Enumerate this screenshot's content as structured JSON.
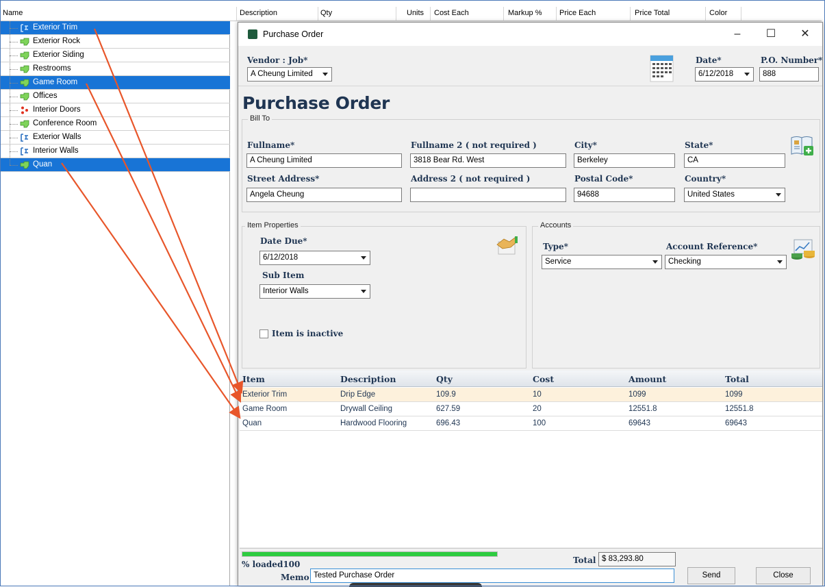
{
  "grid": {
    "columns": [
      "Name",
      "Description",
      "Qty",
      "Units",
      "Cost Each",
      "Markup %",
      "Price Each",
      "Price Total",
      "Color"
    ],
    "tree_items": [
      {
        "label": "Exterior Trim",
        "icon": "tree-node-icon",
        "selected": true
      },
      {
        "label": "Exterior Rock",
        "icon": "green-item-icon",
        "selected": false
      },
      {
        "label": "Exterior Siding",
        "icon": "green-item-icon",
        "selected": false
      },
      {
        "label": "Restrooms",
        "icon": "green-item-icon",
        "selected": false
      },
      {
        "label": "Game Room",
        "icon": "green-item-icon",
        "selected": true
      },
      {
        "label": "Offices",
        "icon": "green-item-icon",
        "selected": false
      },
      {
        "label": "Interior Doors",
        "icon": "red-dots-icon",
        "selected": false
      },
      {
        "label": "Conference Room",
        "icon": "green-item-icon",
        "selected": false
      },
      {
        "label": "Exterior Walls",
        "icon": "tree-node-icon",
        "selected": false
      },
      {
        "label": "Interior Walls",
        "icon": "tree-node-icon",
        "selected": false
      },
      {
        "label": "Quan",
        "icon": "green-item-icon",
        "selected": true
      }
    ]
  },
  "dialog": {
    "title": "Purchase Order",
    "heading": "Purchase Order",
    "vendor_job_label": "Vendor : Job*",
    "vendor_job_value": "A Cheung Limited",
    "date_label": "Date*",
    "date_value": "6/12/2018",
    "po_label": "P.O. Number*",
    "po_value": "888",
    "bill_to": {
      "title": "Bill To",
      "fullname_label": "Fullname*",
      "fullname_value": "A Cheung Limited",
      "fullname2_label": "Fullname 2 ( not required )",
      "fullname2_value": "3818 Bear Rd. West",
      "city_label": "City*",
      "city_value": "Berkeley",
      "state_label": "State*",
      "state_value": "CA",
      "street_label": "Street Address*",
      "street_value": "Angela Cheung",
      "address2_label": "Address 2 ( not required )",
      "address2_value": "",
      "postal_label": "Postal Code*",
      "postal_value": "94688",
      "country_label": "Country*",
      "country_value": "United States"
    },
    "item_properties": {
      "title": "Item Properties",
      "date_due_label": "Date Due*",
      "date_due_value": "6/12/2018",
      "sub_item_label": "Sub Item",
      "sub_item_value": "Interior Walls",
      "inactive_label": "Item is inactive"
    },
    "accounts": {
      "title": "Accounts",
      "type_label": "Type*",
      "type_value": "Service",
      "ref_label": "Account Reference*",
      "ref_value": "Checking"
    },
    "table": {
      "headers": [
        "Item",
        "Description",
        "Qty",
        "Cost",
        "Amount",
        "Total"
      ],
      "rows": [
        [
          "Exterior Trim",
          "Drip Edge",
          "109.9",
          "10",
          "1099",
          "1099"
        ],
        [
          "Game Room",
          "Drywall Ceiling",
          "627.59",
          "20",
          "12551.8",
          "12551.8"
        ],
        [
          "Quan",
          "Hardwood Flooring",
          "696.43",
          "100",
          "69643",
          "69643"
        ]
      ]
    },
    "footer": {
      "progress_fraction": 1.0,
      "loaded_text": "% loaded100",
      "total_label": "Total",
      "total_value": "$ 83,293.80",
      "memo_label": "Memo",
      "memo_value": "Tested Purchase Order",
      "send_label": "Send",
      "close_label": "Close"
    }
  },
  "colors": {
    "selection": "#1874d6",
    "label_text": "#1f3552",
    "arrow": "#e8562a",
    "progress": "#2ecc40"
  }
}
